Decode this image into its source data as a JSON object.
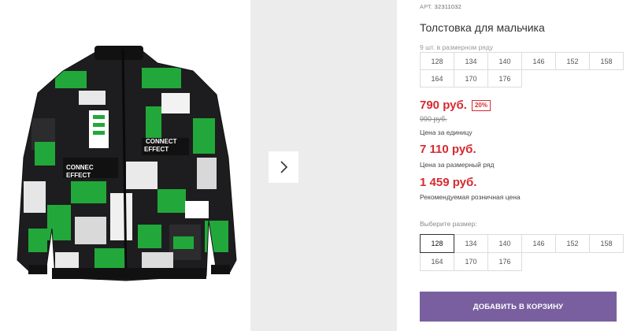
{
  "product": {
    "sku_label": "АРТ.",
    "sku_value": "32311032",
    "title": "Толстовка для мальчика",
    "image_name": "jacket-photo"
  },
  "pack": {
    "note": "9 шт. в размерном ряду",
    "sizes": [
      "128",
      "134",
      "140",
      "146",
      "152",
      "158",
      "164",
      "170",
      "176"
    ]
  },
  "pricing": {
    "unit_price": "790 руб.",
    "discount": "20%",
    "old_price": "990 руб.",
    "unit_caption": "Цена за единицу",
    "pack_price": "7 110 руб.",
    "pack_caption": "Цена за размерный ряд",
    "retail_price": "1 459 руб.",
    "retail_caption": "Рекомендуемая розничная цена"
  },
  "size_select": {
    "label": "Выберите размер:",
    "sizes": [
      "128",
      "134",
      "140",
      "146",
      "152",
      "158",
      "164",
      "170",
      "176"
    ],
    "selected": "128"
  },
  "cart": {
    "button_label": "ДОБАВИТЬ В КОРЗИНУ"
  },
  "icons": {
    "next": "chevron-right-icon"
  },
  "colors": {
    "price": "#d62a30",
    "button": "#7a5fa0",
    "jacket_green": "#22a83a"
  }
}
